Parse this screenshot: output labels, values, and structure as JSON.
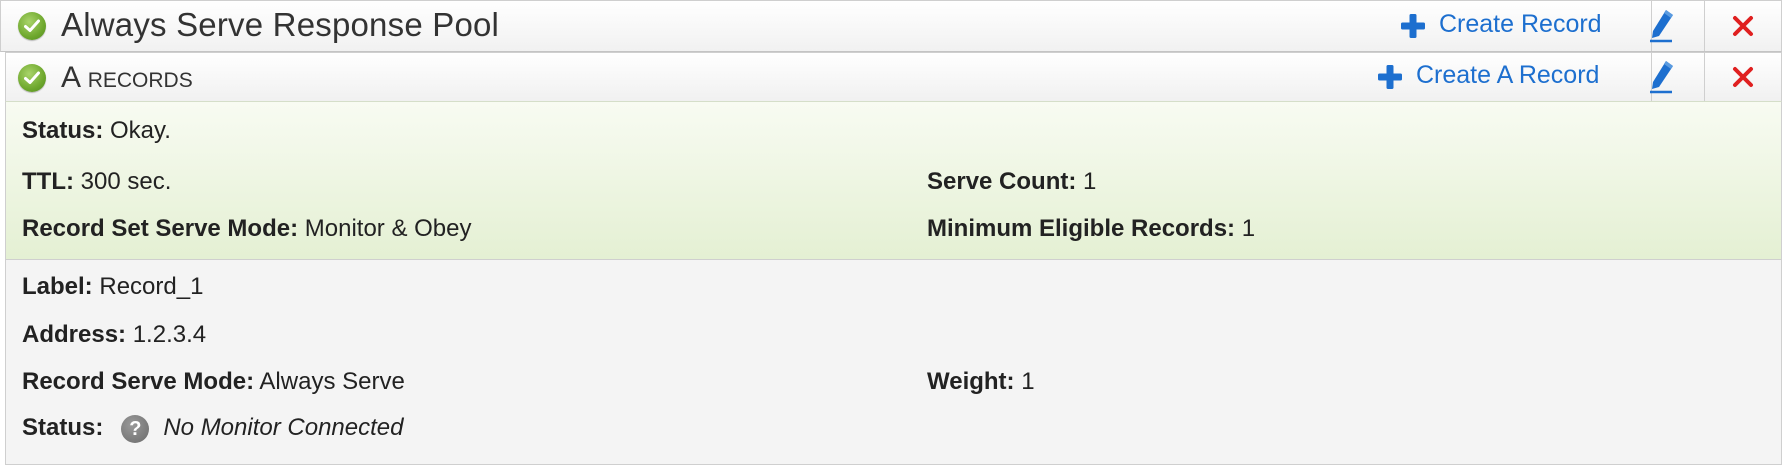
{
  "pool": {
    "title": "Always Serve Response Pool",
    "create_label": "Create Record",
    "status_icon": "check-circle-icon",
    "edit_icon": "pencil-icon",
    "delete_icon": "close-icon"
  },
  "records": {
    "title_initial": "A",
    "title_rest": "records",
    "create_label": "Create A Record",
    "status_icon": "check-circle-icon"
  },
  "record_set": {
    "status_label": "Status:",
    "status_value": "Okay.",
    "ttl_label": "TTL:",
    "ttl_value": "300 sec.",
    "serve_count_label": "Serve Count:",
    "serve_count_value": "1",
    "serve_mode_label": "Record Set Serve Mode:",
    "serve_mode_value": "Monitor & Obey",
    "min_eligible_label": "Minimum Eligible Records:",
    "min_eligible_value": "1"
  },
  "record": {
    "label_label": "Label:",
    "label_value": "Record_1",
    "address_label": "Address:",
    "address_value": "1.2.3.4",
    "serve_mode_label": "Record Serve Mode:",
    "serve_mode_value": "Always Serve",
    "weight_label": "Weight:",
    "weight_value": "1",
    "status_label": "Status:",
    "status_value": "No Monitor Connected",
    "status_icon": "question-icon"
  },
  "colors": {
    "link": "#1d6fcf",
    "delete": "#e02020",
    "ok_green": "#6fa82e",
    "status_panel_bg": "#eef5e2"
  }
}
